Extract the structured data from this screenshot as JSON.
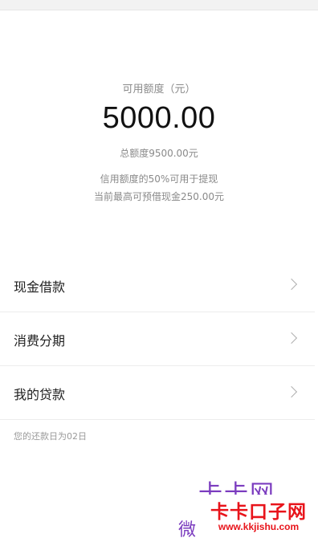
{
  "credit": {
    "label": "可用额度（元）",
    "amount": "5000.00",
    "total": "总额度9500.00元",
    "note_line1": "信用额度的50%可用于提现",
    "note_line2": "当前最高可预借现金250.00元"
  },
  "menu": {
    "items": [
      {
        "label": "现金借款"
      },
      {
        "label": "消费分期"
      },
      {
        "label": "我的贷款"
      }
    ]
  },
  "repayment_note": "您的还款日为02日",
  "watermark": {
    "purple_text": "卡卡网",
    "partial_text": "微",
    "site_name": "卡卡口子网",
    "url": "www.kkjishu.com"
  },
  "colors": {
    "text_primary": "#222222",
    "text_secondary": "#8a8a8a",
    "divider": "#ececec",
    "watermark_red": "#e8141b",
    "watermark_purple": "#7b3cbf"
  },
  "icons": {
    "chevron": "chevron-right-icon"
  }
}
